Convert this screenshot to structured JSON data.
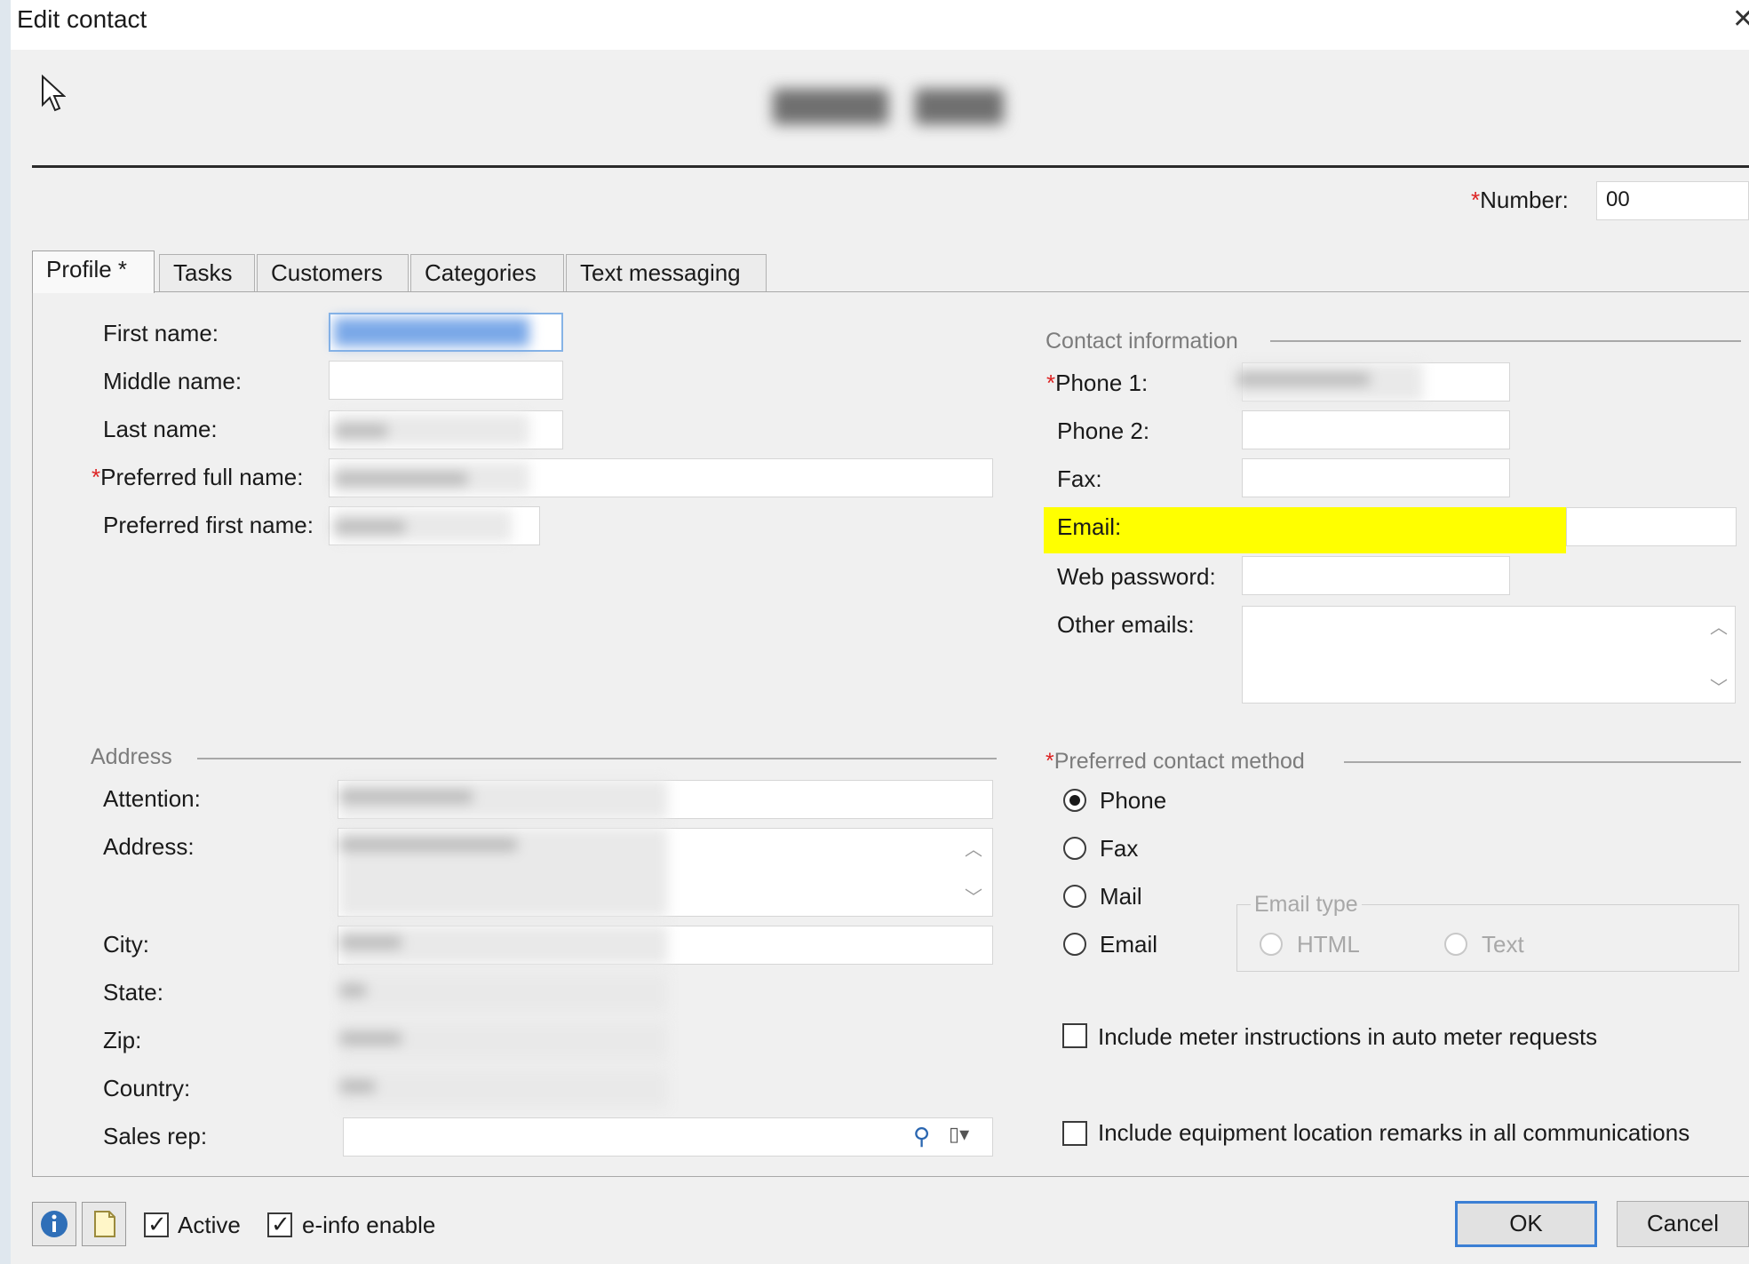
{
  "window": {
    "title": "Edit contact"
  },
  "header": {
    "number_label": "Number:",
    "number_value": "00"
  },
  "tabs": [
    {
      "label": "Profile *"
    },
    {
      "label": "Tasks"
    },
    {
      "label": "Customers"
    },
    {
      "label": "Categories"
    },
    {
      "label": "Text messaging"
    }
  ],
  "name_fields": {
    "first_name": "First name:",
    "middle_name": "Middle name:",
    "last_name": "Last name:",
    "preferred_full_name": "Preferred full name:",
    "preferred_first_name": "Preferred first name:"
  },
  "contact_info": {
    "group_label": "Contact information",
    "phone1": "Phone 1:",
    "phone2": "Phone 2:",
    "fax": "Fax:",
    "email": "Email:",
    "web_password": "Web password:",
    "other_emails": "Other emails:"
  },
  "address": {
    "group_label": "Address",
    "attention": "Attention:",
    "address": "Address:",
    "city": "City:",
    "state": "State:",
    "zip": "Zip:",
    "country": "Country:",
    "sales_rep": "Sales rep:"
  },
  "preferred_contact": {
    "group_label": "Preferred contact method",
    "options": [
      "Phone",
      "Fax",
      "Mail",
      "Email"
    ],
    "selected": "Phone",
    "email_type": {
      "label": "Email type",
      "options": [
        "HTML",
        "Text"
      ]
    }
  },
  "options": {
    "meter_instructions": "Include meter instructions in auto meter requests",
    "equipment_remarks": "Include equipment location remarks in all communications"
  },
  "footer": {
    "active_label": "Active",
    "active_checked": true,
    "einfo_label": "e-info enable",
    "einfo_checked": true,
    "ok_label": "OK",
    "cancel_label": "Cancel"
  },
  "colors": {
    "highlight": "#ffff00",
    "required": "#dd2222",
    "default_button_border": "#3b7fd4"
  },
  "icons": [
    "cursor-icon",
    "close-icon",
    "info-icon",
    "notes-icon",
    "search-icon",
    "dropdown-icon",
    "scroll-up-icon",
    "scroll-down-icon"
  ]
}
